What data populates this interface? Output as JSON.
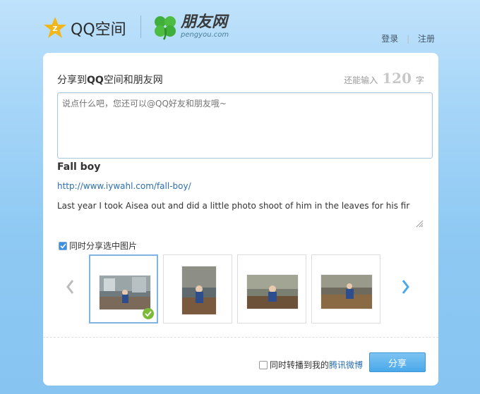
{
  "header": {
    "qzone_logo_text": "QQ空间",
    "pengyou_logo_text": "朋友网",
    "pengyou_logo_sub": "pengyou.com",
    "login": "登录",
    "separator": "|",
    "register": "注册"
  },
  "composer": {
    "title_prefix": "分享到",
    "title_bold": "QQ",
    "title_suffix": "空间和朋友网",
    "counter_prefix": "还能输入",
    "counter_value": "120",
    "counter_suffix": "字",
    "placeholder": "说点什么吧，您还可以@QQ好友和朋友哦~"
  },
  "post": {
    "title": "Fall boy",
    "url": "http://www.iywahl.com/fall-boy/",
    "description": "Last year I took Aisea out and did a little photo shoot of him in the leaves for his first"
  },
  "images": {
    "share_label": "同时分享选中图片",
    "share_checked": true,
    "thumbnails": [
      {
        "name": "thumb-1",
        "selected": true
      },
      {
        "name": "thumb-2",
        "selected": false
      },
      {
        "name": "thumb-3",
        "selected": false
      },
      {
        "name": "thumb-4",
        "selected": false
      }
    ]
  },
  "footer": {
    "repost_label": "同时转播到我的",
    "repost_link": "腾讯微博",
    "share_button": "分享"
  },
  "icons": {
    "qzone": "qzone-star-icon",
    "pengyou": "clover-icon",
    "prev": "chevron-left-icon",
    "next": "chevron-right-icon",
    "check": "check-circle-icon",
    "resize": "resize-grip-icon"
  },
  "colors": {
    "accent": "#4aa8ea",
    "link": "#2a6fb2",
    "check": "#7cbb38",
    "star": "#f2b619"
  }
}
